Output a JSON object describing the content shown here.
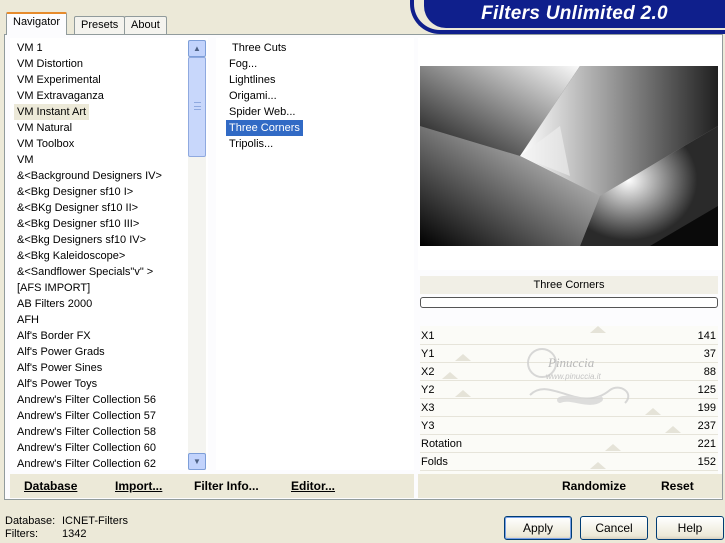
{
  "banner": {
    "title": "Filters Unlimited 2.0"
  },
  "tabs": [
    {
      "label": "Navigator",
      "active": true
    },
    {
      "label": "Presets",
      "active": false
    },
    {
      "label": "About",
      "active": false
    }
  ],
  "categories": {
    "items": [
      "VM 1",
      "VM Distortion",
      "VM Experimental",
      "VM Extravaganza",
      "VM Instant Art",
      "VM Natural",
      "VM Toolbox",
      "VM",
      "&<Background Designers IV>",
      "&<Bkg Designer sf10 I>",
      "&<BKg Designer sf10 II>",
      "&<Bkg Designer sf10 III>",
      "&<Bkg Designers sf10 IV>",
      "&<Bkg Kaleidoscope>",
      "&<Sandflower Specials\"v\" >",
      "[AFS IMPORT]",
      "AB Filters 2000",
      "AFH",
      "Alf's Border FX",
      "Alf's Power Grads",
      "Alf's Power Sines",
      "Alf's Power Toys",
      "Andrew's Filter Collection 56",
      "Andrew's Filter Collection 57",
      "Andrew's Filter Collection 58",
      "Andrew's Filter Collection 60",
      "Andrew's Filter Collection 62"
    ],
    "selected": "VM Instant Art"
  },
  "filters": {
    "items": [
      "Three Cuts",
      "Fog...",
      "Lightlines",
      "Origami...",
      "Spider Web...",
      "Three Corners",
      "Tripolis..."
    ],
    "selected": "Three Corners"
  },
  "preview": {
    "filter_name": "Three Corners",
    "progress": 0
  },
  "params": [
    {
      "name": "X1",
      "value": "141"
    },
    {
      "name": "Y1",
      "value": "37"
    },
    {
      "name": "X2",
      "value": "88"
    },
    {
      "name": "Y2",
      "value": "125"
    },
    {
      "name": "X3",
      "value": "199"
    },
    {
      "name": "Y3",
      "value": "237"
    },
    {
      "name": "Rotation",
      "value": "221"
    },
    {
      "name": "Folds",
      "value": "152"
    }
  ],
  "watermark": {
    "text": "Pinuccia",
    "sub": "www.pinuccia.it"
  },
  "left_actions": {
    "database": "Database",
    "import": "Import...",
    "filter_info": "Filter Info...",
    "editor": "Editor..."
  },
  "right_actions": {
    "randomize": "Randomize",
    "reset": "Reset"
  },
  "status": {
    "database_label": "Database:",
    "database_value": "ICNET-Filters",
    "filters_label": "Filters:",
    "filters_value": "1342"
  },
  "buttons": {
    "apply": "Apply",
    "cancel": "Cancel",
    "help": "Help"
  },
  "icons": {
    "scroll_up": "scroll-up-arrow-icon",
    "scroll_down": "scroll-down-arrow-icon"
  }
}
